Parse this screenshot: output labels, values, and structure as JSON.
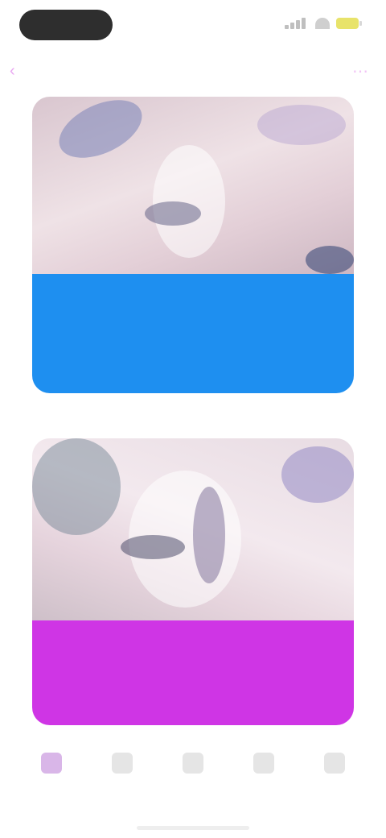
{
  "status_bar": {
    "time": "",
    "battery_color": "#e8e36a"
  },
  "header": {
    "back_label": "",
    "title": "",
    "more_icon": "ellipsis-icon"
  },
  "cards": [
    {
      "heading": "",
      "description": "",
      "panel_color": "#1e8ff0"
    },
    {
      "heading": "",
      "description": "",
      "panel_color": "#cf35e5"
    }
  ],
  "tabs": [
    {
      "label": "",
      "icon": "home-icon",
      "active": true
    },
    {
      "label": "",
      "icon": "grid-icon",
      "active": false
    },
    {
      "label": "",
      "icon": "plus-icon",
      "active": false
    },
    {
      "label": "",
      "icon": "chat-icon",
      "active": false
    },
    {
      "label": "",
      "icon": "profile-icon",
      "active": false
    }
  ],
  "colors": {
    "accent": "#e9a7f2",
    "blue_panel": "#1e8ff0",
    "magenta_panel": "#cf35e5"
  }
}
